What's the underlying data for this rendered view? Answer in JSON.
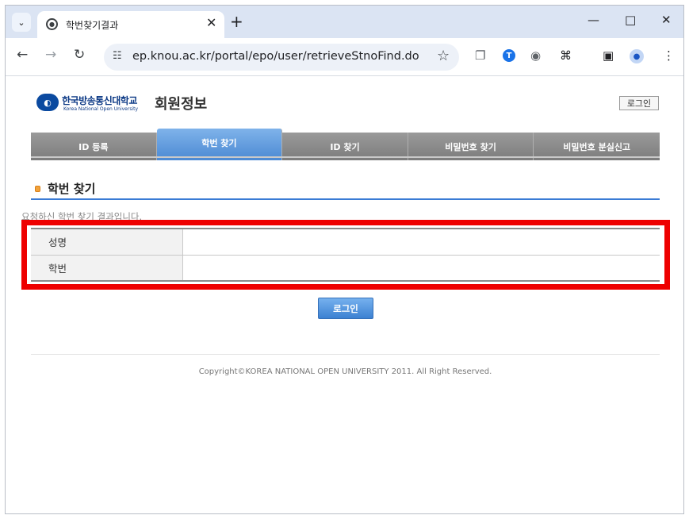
{
  "browser": {
    "tab_title": "학번찾기결과",
    "url": "ep.knou.ac.kr/portal/epo/user/retrieveStnoFind.do",
    "new_tab": "+",
    "tab_close": "✕"
  },
  "header": {
    "logo_ko": "한국방송통신대학교",
    "logo_en": "Korea National Open University",
    "title": "회원정보",
    "login_link": "로그인"
  },
  "tabs": [
    {
      "label": "ID 등록",
      "active": false
    },
    {
      "label": "학번 찾기",
      "active": true
    },
    {
      "label": "ID 찾기",
      "active": false
    },
    {
      "label": "비밀번호 찾기",
      "active": false
    },
    {
      "label": "비밀번호 분실신고",
      "active": false
    }
  ],
  "section": {
    "title": "학번 찾기",
    "description": "요청하신 학번 찾기 결과입니다."
  },
  "result": {
    "rows": [
      {
        "label": "성명",
        "value": ""
      },
      {
        "label": "학번",
        "value": ""
      }
    ]
  },
  "login_button": "로그인",
  "footer": {
    "copyright": "Copyright©KOREA NATIONAL OPEN UNIVERSITY 2011. All Right Reserved."
  },
  "colors": {
    "accent": "#3a7bd5",
    "highlight": "#ee0000",
    "active_tab": "#4b89d3"
  }
}
